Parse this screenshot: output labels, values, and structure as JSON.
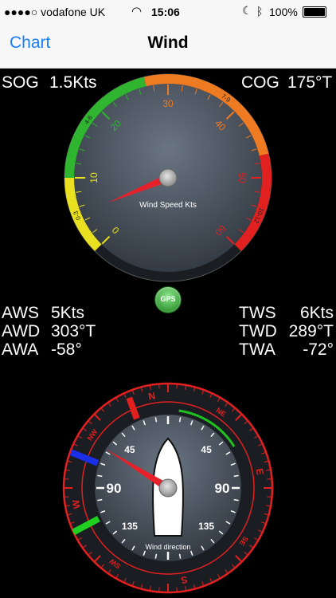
{
  "status_bar": {
    "carrier": "●●●●○ vodafone UK",
    "time": "15:06",
    "battery": "100%",
    "icons": [
      "wifi-icon",
      "moon-icon",
      "bluetooth-icon",
      "battery-icon"
    ]
  },
  "nav": {
    "back_label": "Chart",
    "title": "Wind"
  },
  "readouts": {
    "sog": {
      "label": "SOG",
      "value": "1.5Kts"
    },
    "cog": {
      "label": "COG",
      "value": "175°T"
    },
    "aws": {
      "label": "AWS",
      "value": "5Kts"
    },
    "awd": {
      "label": "AWD",
      "value": "303°T"
    },
    "awa": {
      "label": "AWA",
      "value": "-58°"
    },
    "tws": {
      "label": "TWS",
      "value": "6Kts"
    },
    "twd": {
      "label": "TWD",
      "value": "289°T"
    },
    "twa": {
      "label": "TWA",
      "value": "-72°"
    }
  },
  "speed_gauge": {
    "caption": "Wind Speed Kts",
    "value_kts": 5,
    "scale_labels": [
      "0",
      "10",
      "20",
      "30",
      "40",
      "50",
      "60"
    ],
    "zone_labels": [
      "0-3",
      "4-6",
      "7-9",
      "10-12"
    ],
    "colors": {
      "yellow": "#e8e020",
      "green": "#2fb52f",
      "orange": "#ee7a22",
      "red": "#e32020",
      "needle": "#e8202a"
    }
  },
  "gps_button": {
    "label": "GPS"
  },
  "compass": {
    "caption": "Wind direction",
    "cardinals": [
      "N",
      "NE",
      "E",
      "SE",
      "S",
      "SW",
      "W",
      "NW"
    ],
    "angle_labels": [
      "45",
      "45",
      "90",
      "90",
      "135",
      "135"
    ],
    "wind_angle_deg": -58,
    "colors": {
      "ring": "#e32020",
      "port": "#1a2fe8",
      "starboard": "#20d020",
      "arc": "#20c020"
    }
  }
}
